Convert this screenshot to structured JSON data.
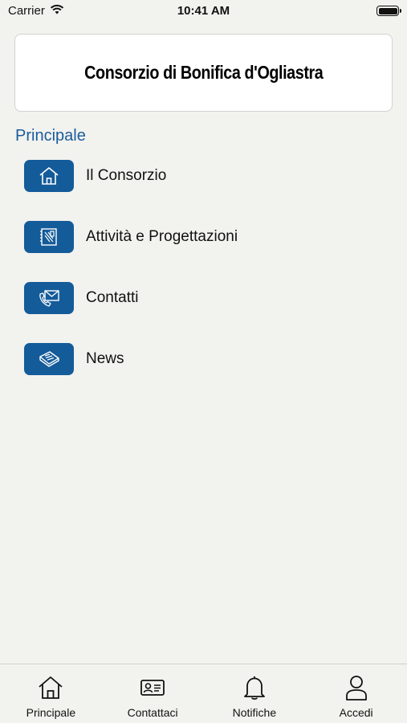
{
  "status_bar": {
    "carrier": "Carrier",
    "time": "10:41 AM"
  },
  "header": {
    "title": "Consorzio di Bonifica d'Ogliastra"
  },
  "section": {
    "title": "Principale"
  },
  "menu": {
    "items": [
      {
        "label": "Il Consorzio",
        "icon": "home-icon"
      },
      {
        "label": "Attività e Progettazioni",
        "icon": "blueprint-icon"
      },
      {
        "label": "Contatti",
        "icon": "phone-mail-icon"
      },
      {
        "label": "News",
        "icon": "newspaper-icon"
      }
    ]
  },
  "tabs": [
    {
      "label": "Principale",
      "icon": "home-icon"
    },
    {
      "label": "Contattaci",
      "icon": "contact-card-icon"
    },
    {
      "label": "Notifiche",
      "icon": "bell-icon"
    },
    {
      "label": "Accedi",
      "icon": "user-icon"
    }
  ],
  "colors": {
    "accent": "#145b9a",
    "section_title": "#1a5c9c",
    "background": "#f2f2ee"
  }
}
